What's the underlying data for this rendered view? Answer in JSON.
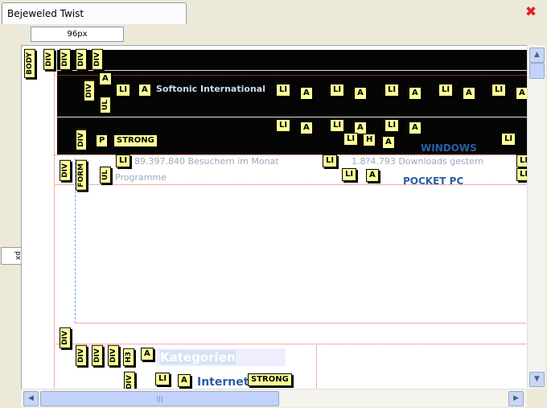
{
  "tab": {
    "title": "Bejeweled Twist"
  },
  "ruler": {
    "width_value": "96px",
    "vertical_label": "px"
  },
  "content": {
    "nav_link": "Softonic International",
    "stats_text": "89.397.840 Besuchern im Monat",
    "downloads_text": "1.8?4.793 Downloads gestern",
    "programme": "Programme",
    "windows": "WINDOWS",
    "pocket_pc": "POCKET PC",
    "kategorien": "Kategorien",
    "internet": "Internet"
  },
  "tags": {
    "body": "BODY",
    "div": "DIV",
    "ul": "UL",
    "li": "LI",
    "a": "A",
    "p": "P",
    "strong": "STRONG",
    "form": "FORM",
    "h3": "H3",
    "h": "H"
  },
  "scroll": {
    "up": "▲",
    "down": "▼",
    "left": "◀",
    "right": "▶",
    "grip": "|||"
  },
  "colors": {
    "accent_blue": "#2a5ea8",
    "overlay_line": "#e55555",
    "tag_bg": "#ffff9a"
  }
}
